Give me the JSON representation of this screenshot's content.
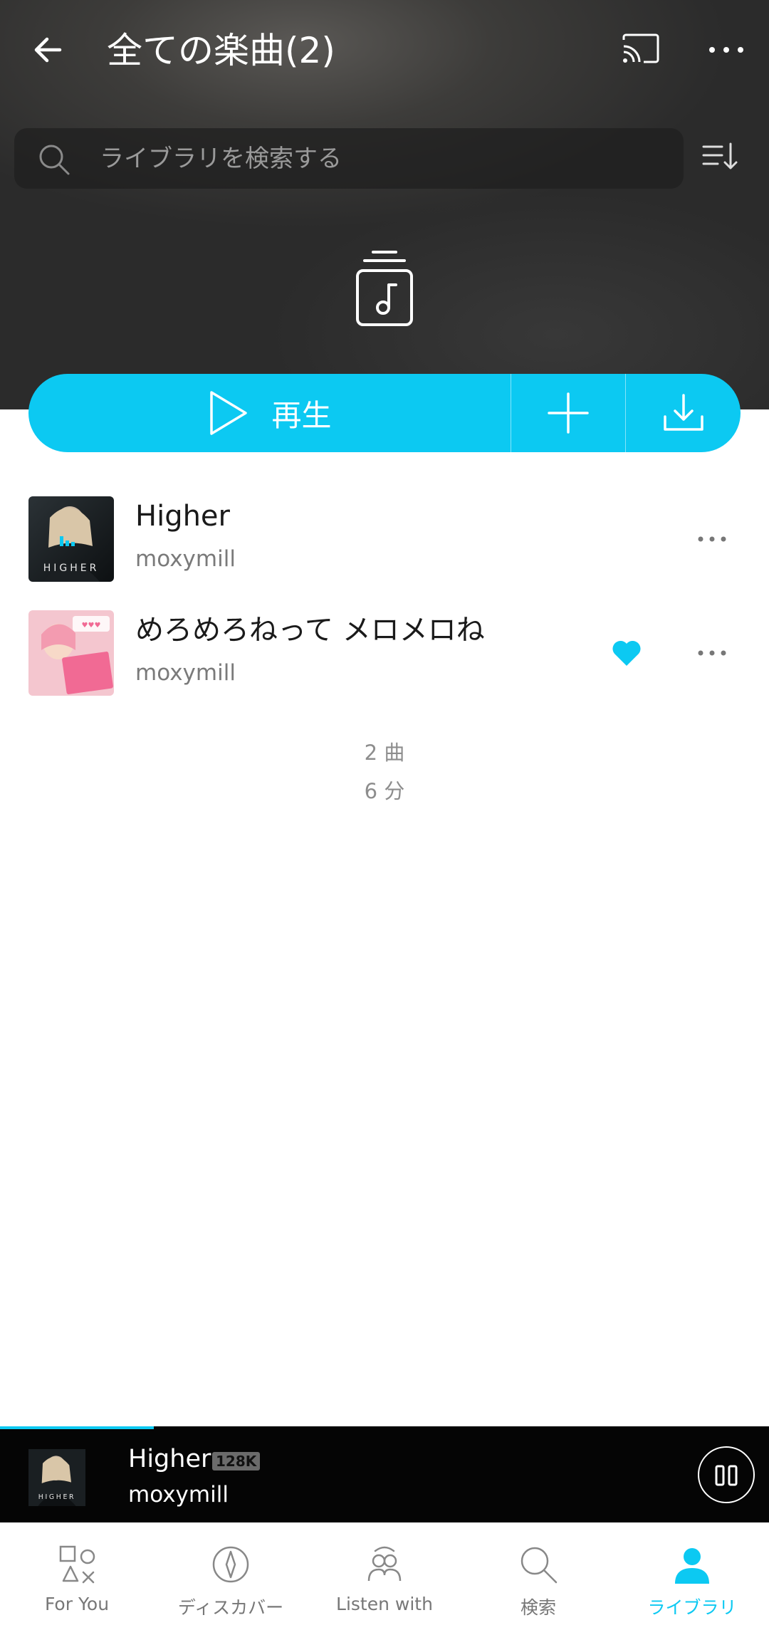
{
  "header": {
    "title": "全ての楽曲(2)",
    "back_icon": "back-arrow-icon",
    "cast_icon": "cast-icon",
    "more_icon": "more-horizontal-icon"
  },
  "search": {
    "placeholder": "ライブラリを検索する",
    "value": "",
    "sort_icon": "sort-icon"
  },
  "actions": {
    "play_label": "再生",
    "add_icon": "plus-icon",
    "download_icon": "download-icon"
  },
  "tracks": [
    {
      "title": "Higher",
      "artist": "moxymill",
      "liked": false,
      "now_playing": true
    },
    {
      "title": "めろめろねって メロメロね",
      "artist": "moxymill",
      "liked": true,
      "now_playing": false
    }
  ],
  "summary": {
    "count": "2 曲",
    "duration": "6 分"
  },
  "mini_player": {
    "title": "Higher",
    "quality_badge": "128K",
    "artist": "moxymill",
    "progress": 0.2
  },
  "nav": [
    {
      "label": "For You",
      "icon": "shapes-icon",
      "active": false
    },
    {
      "label": "ディスカバー",
      "icon": "compass-icon",
      "active": false
    },
    {
      "label": "Listen with",
      "icon": "people-icon",
      "active": false
    },
    {
      "label": "検索",
      "icon": "search-icon",
      "active": false
    },
    {
      "label": "ライブラリ",
      "icon": "user-icon",
      "active": true
    }
  ],
  "colors": {
    "accent": "#0cc9f2",
    "header_bg": "#3a3a3a",
    "mini_player_bg": "#050505"
  }
}
